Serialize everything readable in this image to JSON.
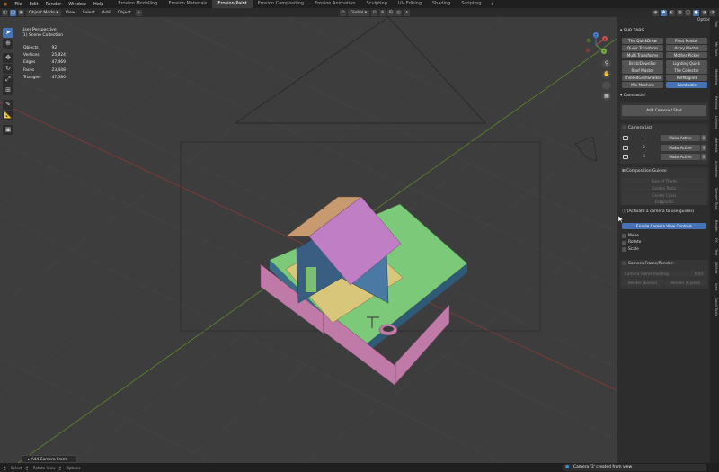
{
  "menu": [
    "File",
    "Edit",
    "Render",
    "Window",
    "Help"
  ],
  "workspaces": [
    {
      "label": "Erosion Modelling",
      "active": false
    },
    {
      "label": "Erosion Materials",
      "active": false
    },
    {
      "label": "Erosion Paint",
      "active": true
    },
    {
      "label": "Erosion Compositing",
      "active": false
    },
    {
      "label": "Erosion Animation",
      "active": false
    },
    {
      "label": "Sculpting",
      "active": false
    },
    {
      "label": "UV Editing",
      "active": false
    },
    {
      "label": "Shading",
      "active": false
    },
    {
      "label": "Scripting",
      "active": false
    }
  ],
  "header": {
    "mode": "Object Mode",
    "menus": [
      "View",
      "Select",
      "Add",
      "Object"
    ],
    "transform": "Global",
    "options": "Options"
  },
  "viewport": {
    "perspective": "User Perspective",
    "collection": "(1) Scene Collection",
    "stats": [
      {
        "label": "Objects",
        "value": "92"
      },
      {
        "label": "Vertices",
        "value": "25,924"
      },
      {
        "label": "Edges",
        "value": "47,469"
      },
      {
        "label": "Faces",
        "value": "23,448"
      },
      {
        "label": "Triangles",
        "value": "47,580"
      }
    ],
    "gizmo": {
      "x": "X",
      "y": "Y",
      "z": "Z"
    },
    "add_camera_label": "Add Camera From View"
  },
  "sidebar": {
    "sub_tabs_title": "SUB TABS",
    "sub_tabs": [
      {
        "label": "The QuickDraw",
        "active": false
      },
      {
        "label": "Pivot Master",
        "active": false
      },
      {
        "label": "Quick Transform",
        "active": false
      },
      {
        "label": "Array Master",
        "active": false
      },
      {
        "label": "Multi Transforms",
        "active": false
      },
      {
        "label": "Mother Picker",
        "active": false
      },
      {
        "label": "BrickIDownFor",
        "active": false
      },
      {
        "label": "Lighting Quick",
        "active": false
      },
      {
        "label": "Roof Master",
        "active": false
      },
      {
        "label": "The Collector",
        "active": false
      },
      {
        "label": "TheRedGrimShader",
        "active": false
      },
      {
        "label": "RefMagnet",
        "active": false
      },
      {
        "label": "Mix Machine",
        "active": false
      },
      {
        "label": "Camtastic",
        "active": true
      }
    ],
    "camtastic_title": "Camtastic!",
    "add_camera_shot": "Add Camera / Shot",
    "camera_list_title": "Camera List:",
    "cameras": [
      {
        "index": "1",
        "action": "Make Active"
      },
      {
        "index": "2",
        "action": "Make Active"
      },
      {
        "index": "3",
        "action": "Make Active"
      }
    ],
    "remove_symbol": "X",
    "composition_title": "Composition Guides:",
    "guides": [
      "Rule of Thirds",
      "Golden Ratio",
      "Center Cross",
      "Diagonals"
    ],
    "activate_hint": "(Activate a camera to use guides)",
    "enable_controls": "Enable Camera View Controls",
    "controls": [
      "Move",
      "Rotate",
      "Scale"
    ],
    "frame_title": "Camera Frame/Render:",
    "frame_slider_label": "Camera Frame Padding",
    "frame_slider_value": "0.00",
    "render_buttons": [
      "Render (Eevee)",
      "Render (Cycles)"
    ],
    "tabs": [
      "Tool",
      "My Tools",
      "Modelling",
      "Painting",
      "Lighting",
      "Materials",
      "Animation",
      "Scenery Tools",
      "Render",
      "FX",
      "Text",
      "Utilities",
      "View",
      "Quick Tools"
    ]
  },
  "status": {
    "items": [
      "Select",
      "Rotate View",
      "Options"
    ],
    "toast": "Camera '3' created from view"
  }
}
